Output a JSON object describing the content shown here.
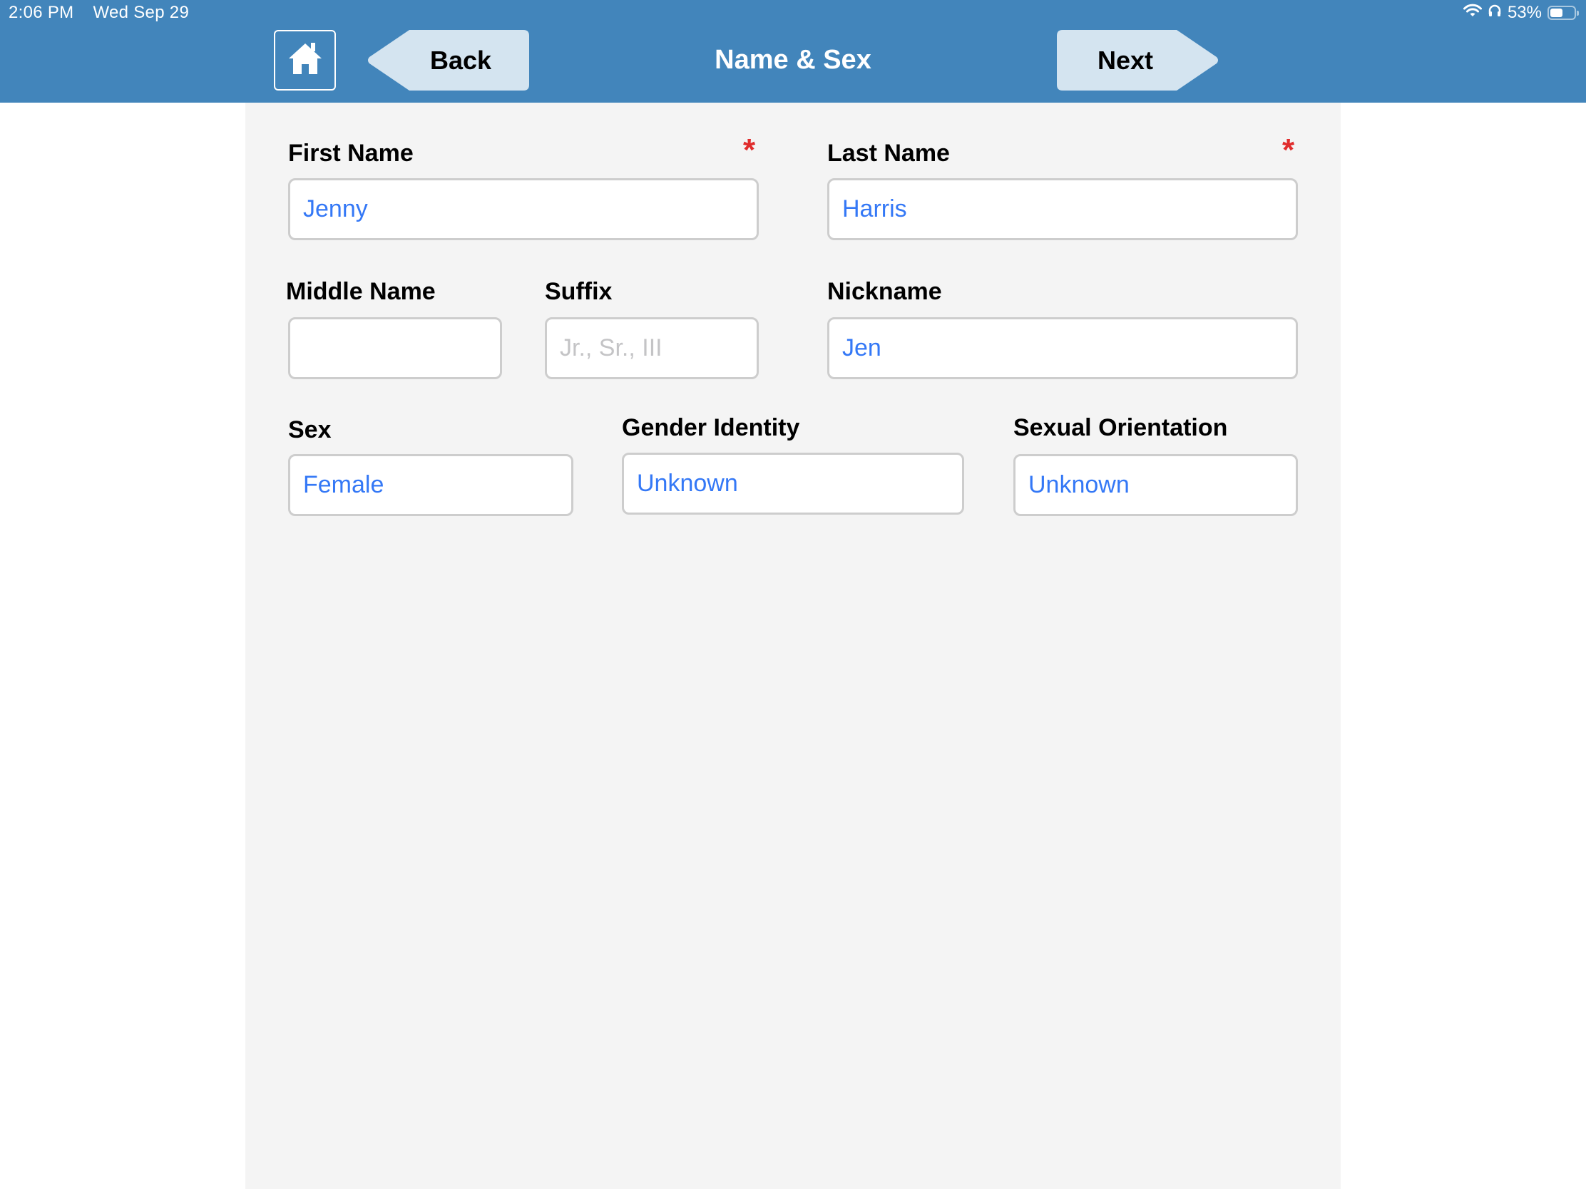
{
  "status_bar": {
    "time": "2:06 PM",
    "date": "Wed Sep 29",
    "battery_percent_label": "53%",
    "battery_level": 0.53,
    "icons": [
      "wifi-icon",
      "headphones-icon",
      "battery-icon"
    ]
  },
  "header": {
    "home_icon": "home-icon",
    "back_label": "Back",
    "title": "Name & Sex",
    "next_label": "Next"
  },
  "colors": {
    "header_bg": "#4285BB",
    "button_bg": "#D4E4F0",
    "panel_bg": "#F4F4F4",
    "value_text": "#3478F6",
    "placeholder_text": "#C4C4C6",
    "required_marker": "#E02C2C"
  },
  "form": {
    "first_name": {
      "label": "First Name",
      "value": "Jenny",
      "required": true,
      "required_marker": "*"
    },
    "last_name": {
      "label": "Last Name",
      "value": "Harris",
      "required": true,
      "required_marker": "*"
    },
    "middle_name": {
      "label": "Middle Name",
      "value": ""
    },
    "suffix": {
      "label": "Suffix",
      "value": "",
      "placeholder": "Jr., Sr., III"
    },
    "nickname": {
      "label": "Nickname",
      "value": "Jen"
    },
    "sex": {
      "label": "Sex",
      "value": "Female"
    },
    "gender_identity": {
      "label": "Gender Identity",
      "value": "Unknown"
    },
    "sexual_orientation": {
      "label": "Sexual Orientation",
      "value": "Unknown"
    }
  }
}
